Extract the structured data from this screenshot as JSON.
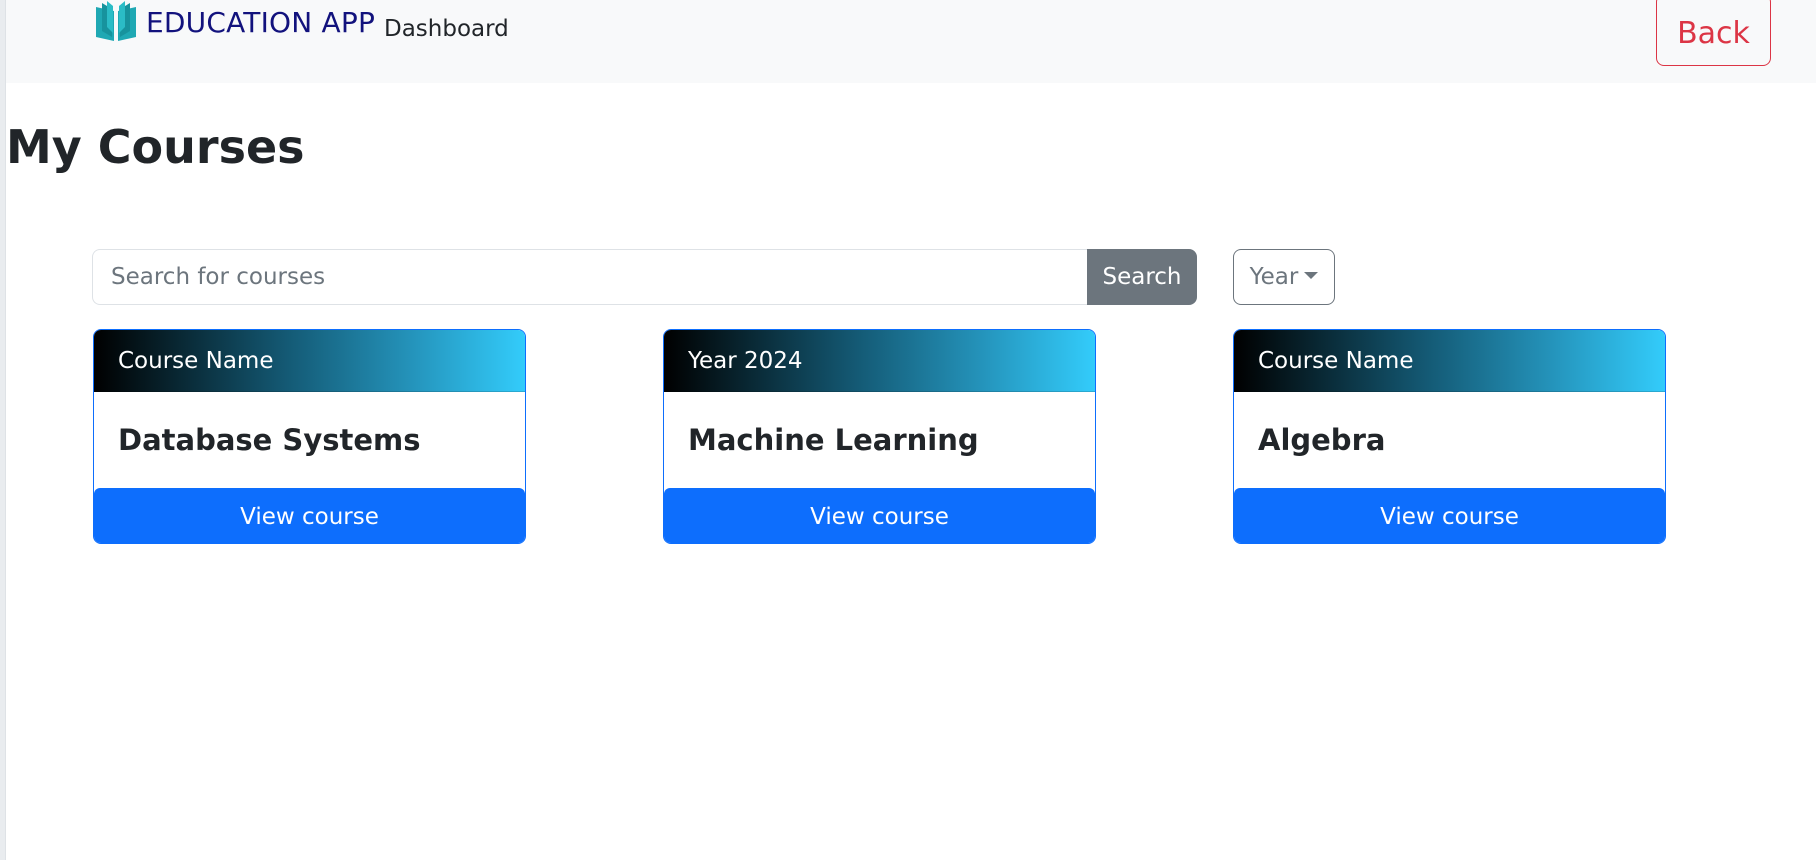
{
  "navbar": {
    "brand_text": "EDUCATION APP",
    "brand_icon": "open-book-icon",
    "dashboard_link": "Dashboard",
    "back_label": "Back"
  },
  "page": {
    "title": "My Courses"
  },
  "search": {
    "placeholder": "Search for courses",
    "value": "",
    "button_label": "Search"
  },
  "filter": {
    "year_label": "Year"
  },
  "colors": {
    "brand_text": "#12127d",
    "brand_icon": "#1fa8b3",
    "primary": "#0d6efd",
    "danger": "#dc3545",
    "secondary": "#6c757d"
  },
  "courses": [
    {
      "header": "Course Name",
      "title": "Database Systems",
      "button_label": "View course"
    },
    {
      "header": "Year 2024",
      "title": "Machine Learning",
      "button_label": "View course"
    },
    {
      "header": "Course Name",
      "title": "Algebra",
      "button_label": "View course"
    }
  ]
}
